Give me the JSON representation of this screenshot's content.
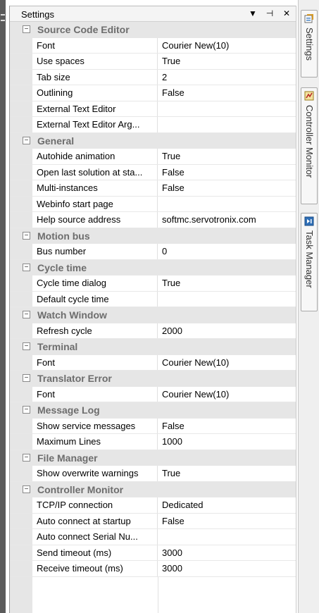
{
  "window": {
    "title": "Settings",
    "buttons": {
      "dropdown": "▼",
      "pin": "⊣",
      "close": "✕"
    }
  },
  "categories": [
    {
      "label": "Source Code Editor",
      "toggle": "−",
      "props": [
        {
          "name": "Font",
          "value": "Courier New(10)"
        },
        {
          "name": "Use spaces",
          "value": "True"
        },
        {
          "name": "Tab size",
          "value": "2"
        },
        {
          "name": "Outlining",
          "value": "False"
        },
        {
          "name": "External Text Editor",
          "value": ""
        },
        {
          "name": "External Text Editor Arg...",
          "value": ""
        }
      ]
    },
    {
      "label": "General",
      "toggle": "−",
      "props": [
        {
          "name": "Autohide animation",
          "value": "True"
        },
        {
          "name": "Open last solution at sta...",
          "value": "False"
        },
        {
          "name": "Multi-instances",
          "value": "False"
        },
        {
          "name": "Webinfo start page",
          "value": ""
        },
        {
          "name": "Help source address",
          "value": "softmc.servotronix.com"
        }
      ]
    },
    {
      "label": "Motion bus",
      "toggle": "−",
      "props": [
        {
          "name": "Bus number",
          "value": "0"
        }
      ]
    },
    {
      "label": "Cycle time",
      "toggle": "−",
      "props": [
        {
          "name": "Cycle time dialog",
          "value": "True"
        },
        {
          "name": "Default cycle time",
          "value": ""
        }
      ]
    },
    {
      "label": "Watch Window",
      "toggle": "−",
      "props": [
        {
          "name": "Refresh cycle",
          "value": "2000"
        }
      ]
    },
    {
      "label": "Terminal",
      "toggle": "−",
      "props": [
        {
          "name": "Font",
          "value": "Courier New(10)"
        }
      ]
    },
    {
      "label": "Translator Error",
      "toggle": "−",
      "props": [
        {
          "name": "Font",
          "value": "Courier New(10)"
        }
      ]
    },
    {
      "label": "Message Log",
      "toggle": "−",
      "props": [
        {
          "name": "Show service messages",
          "value": "False"
        },
        {
          "name": "Maximum Lines",
          "value": "1000"
        }
      ]
    },
    {
      "label": "File Manager",
      "toggle": "−",
      "props": [
        {
          "name": "Show overwrite warnings",
          "value": "True"
        }
      ]
    },
    {
      "label": "Controller Monitor",
      "toggle": "−",
      "props": [
        {
          "name": "TCP/IP connection",
          "value": "Dedicated"
        },
        {
          "name": "Auto connect at startup",
          "value": "False"
        },
        {
          "name": "Auto connect Serial Nu...",
          "value": ""
        },
        {
          "name": "Send timeout (ms)",
          "value": "3000"
        },
        {
          "name": "Receive timeout (ms)",
          "value": "3000"
        }
      ]
    }
  ],
  "dock_tabs": [
    {
      "label": "Settings",
      "icon": "settings-icon"
    },
    {
      "label": "Controller Monitor",
      "icon": "controller-monitor-icon"
    },
    {
      "label": "Task Manager",
      "icon": "task-manager-icon"
    }
  ]
}
